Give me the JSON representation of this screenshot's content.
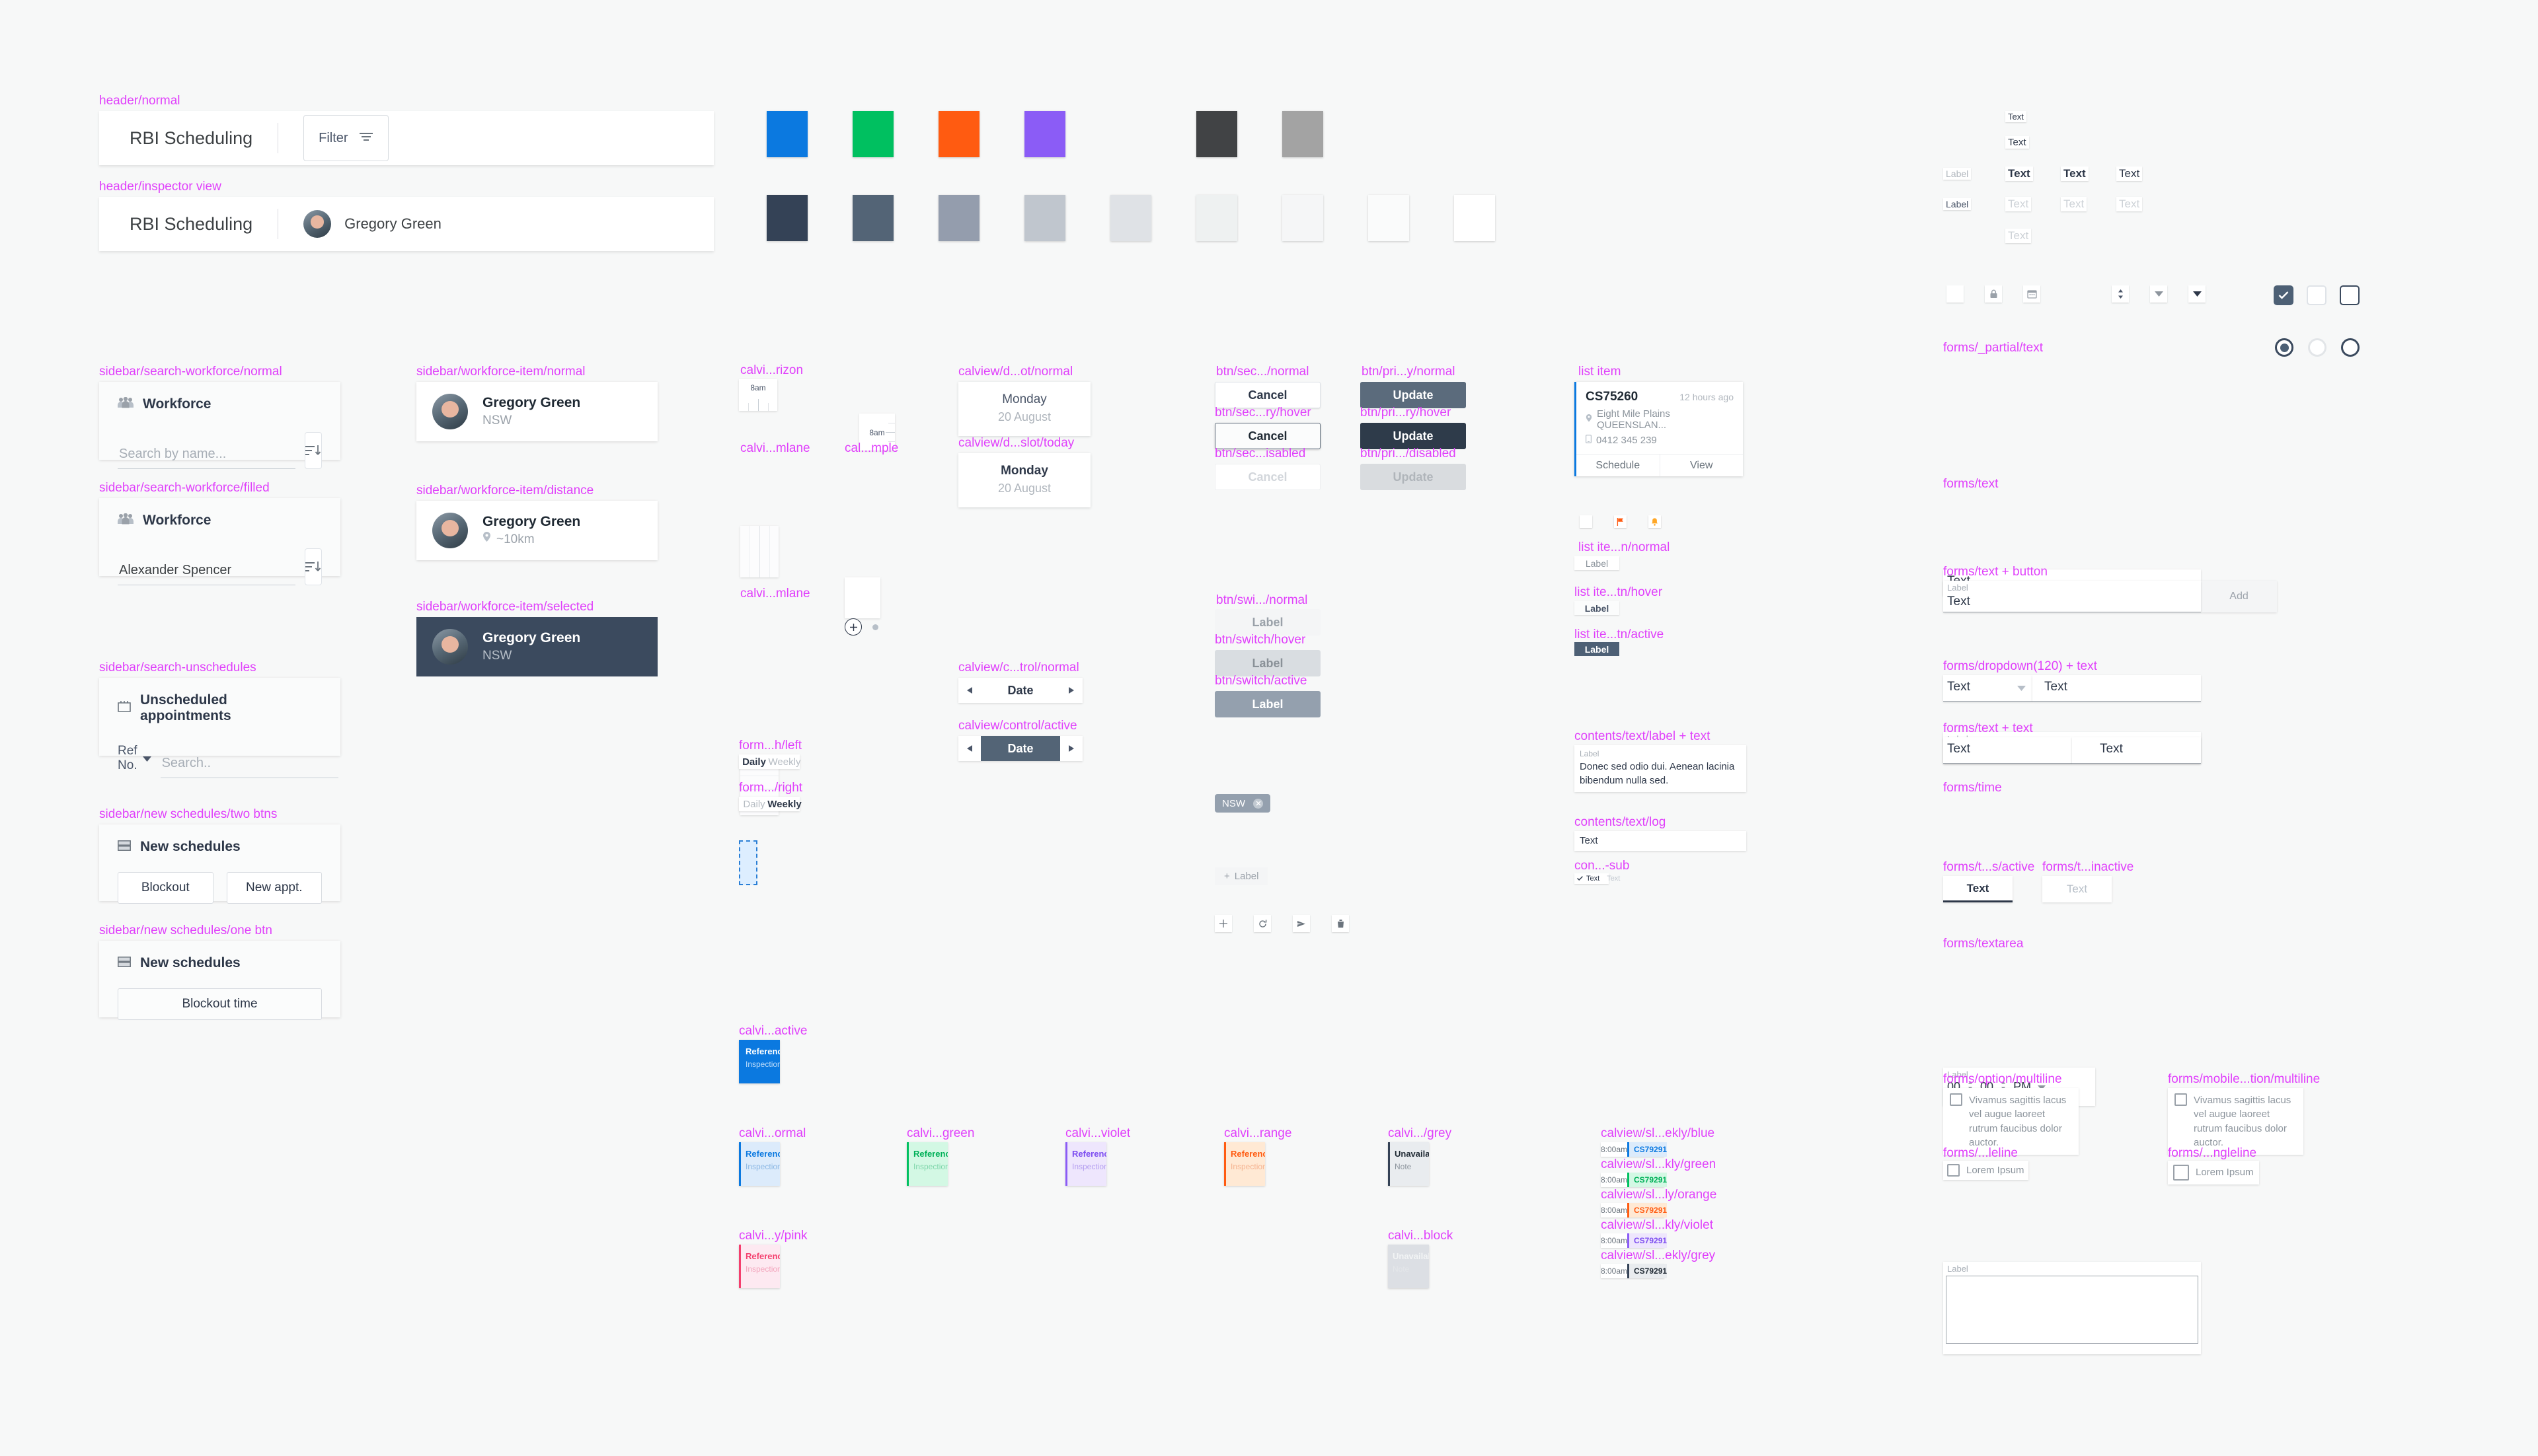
{
  "headers": {
    "normal_label": "header/normal",
    "inspector_label": "header/inspector view",
    "title": "RBI Scheduling",
    "filter_label": "Filter",
    "user_name": "Gregory Green"
  },
  "swatches": {
    "row1": [
      "#0b79e0",
      "#00c060",
      "#ff5b11",
      "#8b5cf6",
      "",
      "#414345",
      "#a3a3a3"
    ],
    "row2": [
      "#344256",
      "#536476",
      "#949dad",
      "#c0c6ce",
      "#dfe2e6",
      "#eef1f1",
      "#f5f6f7",
      "#fafbfb",
      "#ffffff"
    ]
  },
  "sidebar": {
    "search_workforce_normal_label": "sidebar/search-workforce/normal",
    "search_workforce_filled_label": "sidebar/search-workforce/filled",
    "search_unschedules_label": "sidebar/search-unschedules",
    "new_schedules_two_label": "sidebar/new schedules/two btns",
    "new_schedules_one_label": "sidebar/new schedules/one btn",
    "workforce_title": "Workforce",
    "search_placeholder": "Search by name...",
    "search_value": "Alexander Spencer",
    "unscheduled_title": "Unscheduled appointments",
    "ref_no_label": "Ref No.",
    "ref_search_placeholder": "Search..",
    "new_schedules_title": "New schedules",
    "blockout_label": "Blockout",
    "new_appt_label": "New appt.",
    "blockout_time_label": "Blockout time"
  },
  "workforce_items": {
    "normal_label": "sidebar/workforce-item/normal",
    "distance_label": "sidebar/workforce-item/distance",
    "selected_label": "sidebar/workforce-item/selected",
    "name": "Gregory Green",
    "state": "NSW",
    "distance": "~10km"
  },
  "calviews": {
    "horizon_label": "calvi...rizon",
    "timelane_label": "calvi...mlane",
    "sample_label": "cal...mple",
    "timelane2_label": "calvi...mlane",
    "time_8am": "8am",
    "dateslot_normal_label": "calview/d...ot/normal",
    "dateslot_today_label": "calview/d...slot/today",
    "control_normal_label": "calview/c...trol/normal",
    "control_active_label": "calview/control/active",
    "day": "Monday",
    "date": "20 August",
    "control_text": "Date",
    "toggle_left_label": "form...h/left",
    "toggle_right_label": "form.../right",
    "daily": "Daily",
    "weekly": "Weekly"
  },
  "buttons": {
    "sec_normal_label": "btn/sec.../normal",
    "sec_hover_label": "btn/sec...ry/hover",
    "sec_disabled_label": "btn/sec...isabled",
    "pri_normal_label": "btn/pri...y/normal",
    "pri_hover_label": "btn/pri...ry/hover",
    "pri_disabled_label": "btn/pri.../disabled",
    "switch_normal_label": "btn/swi.../normal",
    "switch_hover_label": "btn/switch/hover",
    "switch_active_label": "btn/switch/active",
    "cancel": "Cancel",
    "update": "Update",
    "label": "Label"
  },
  "chip": {
    "text": "NSW"
  },
  "add_button": {
    "text": "Label",
    "plus": "+"
  },
  "icon_buttons": [
    "plus-icon",
    "refresh-icon",
    "send-icon",
    "trash-icon"
  ],
  "list_item": {
    "section_label": "list item",
    "btn_normal_label": "list ite...n/normal",
    "btn_hover_label": "list ite...tn/hover",
    "btn_active_label": "list ite...tn/active",
    "ref": "CS75260",
    "time_ago": "12 hours ago",
    "address": "Eight Mile Plains QUEENSLAN...",
    "phone": "0412 345 239",
    "action_schedule": "Schedule",
    "action_view": "View",
    "btn_label": "Label"
  },
  "contents": {
    "label_text_label": "contents/text/label + text",
    "log_label": "contents/text/log",
    "sub_label": "con...-sub",
    "label": "Label",
    "paragraph": "Donec sed odio dui. Aenean lacinia bibendum nulla sed.",
    "log_text": "Text",
    "sub_text_a": "Text",
    "sub_text_b": "Text"
  },
  "forms": {
    "partial_text_label": "forms/_partial/text",
    "text_label": "forms/text",
    "text_button_label": "forms/text + button",
    "dropdown_text_label": "forms/dropdown(120) + text",
    "text_text_label": "forms/text + text",
    "time_label": "forms/time",
    "tabs_active_label": "forms/t...s/active",
    "tabs_inactive_label": "forms/t...inactive",
    "textarea_label": "forms/textarea",
    "option_multiline_label": "forms/option/multiline",
    "mobile_multiline_label": "forms/mobile...tion/multiline",
    "singleline_label": "forms/...leline",
    "mobile_singleline_label": "forms/...ngleline",
    "label": "Label",
    "text": "Text",
    "add_label": "Add",
    "time_hour": "00",
    "time_minute": "00",
    "time_meridiem": "PM",
    "option_paragraph": "Vivamus sagittis lacus vel augue laoreet rutrum faucibus dolor auctor.",
    "lorem": "Lorem Ipsum"
  },
  "type_specimens": {
    "label": "Label",
    "text": "Text"
  },
  "cal_events": {
    "active_label": "calvi...active",
    "normal_label": "calvi...ormal",
    "green_label": "calvi...green",
    "violet_label": "calvi...violet",
    "orange_label": "calvi...range",
    "grey_label": "calvi.../grey",
    "pink_label": "calvi...y/pink",
    "block_label": "calvi...block",
    "reference": "Reference",
    "inspection": "Inspection ty",
    "unavailable": "Unavailable",
    "note": "Note"
  },
  "weekly_slots": {
    "blue_label": "calview/sl...ekly/blue",
    "green_label": "calview/sl...kly/green",
    "orange_label": "calview/sl...ly/orange",
    "violet_label": "calview/sl...kly/violet",
    "grey_label": "calview/sl...ekly/grey",
    "time": "8:00am",
    "ref": "CS79291"
  },
  "colors": {
    "accent_blue": "#0b79e0",
    "accent_green": "#00c060",
    "accent_orange": "#ff5b11",
    "accent_violet": "#8b5cf6",
    "accent_pink": "#f43f6e",
    "dark_slate": "#344256",
    "figma_label": "#e040fb"
  }
}
